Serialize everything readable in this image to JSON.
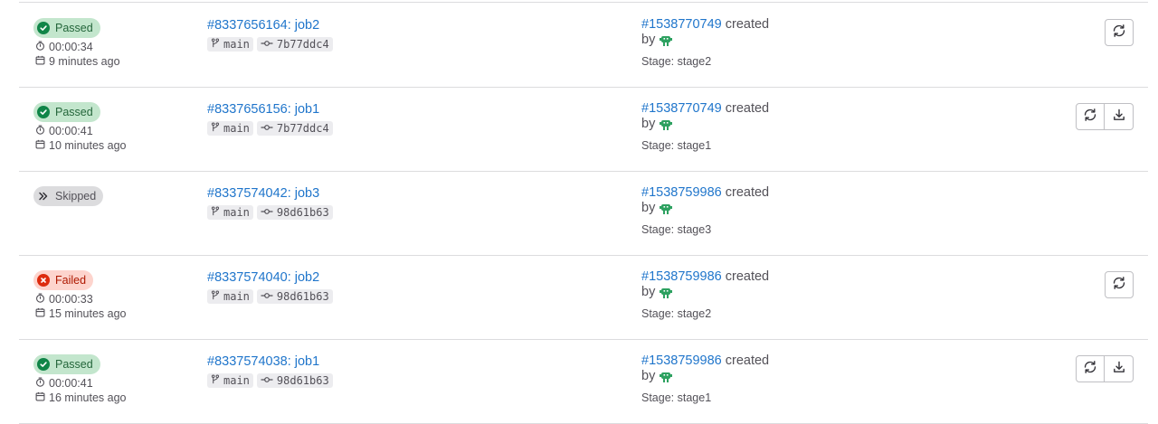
{
  "rows": [
    {
      "status": "Passed",
      "status_kind": "success",
      "duration": "00:00:34",
      "finished": "9 minutes ago",
      "job": "#8337656164: job2",
      "ref": "main",
      "commit": "7b77ddc4",
      "pipeline": "#1538770749",
      "created": "created",
      "by": "by",
      "stage": "Stage: stage2",
      "actions": [
        "retry"
      ]
    },
    {
      "status": "Passed",
      "status_kind": "success",
      "duration": "00:00:41",
      "finished": "10 minutes ago",
      "job": "#8337656156: job1",
      "ref": "main",
      "commit": "7b77ddc4",
      "pipeline": "#1538770749",
      "created": "created",
      "by": "by",
      "stage": "Stage: stage1",
      "actions": [
        "retry",
        "download"
      ]
    },
    {
      "status": "Skipped",
      "status_kind": "skipped",
      "duration": "",
      "finished": "",
      "job": "#8337574042: job3",
      "ref": "main",
      "commit": "98d61b63",
      "pipeline": "#1538759986",
      "created": "created",
      "by": "by",
      "stage": "Stage: stage3",
      "actions": []
    },
    {
      "status": "Failed",
      "status_kind": "failed",
      "duration": "00:00:33",
      "finished": "15 minutes ago",
      "job": "#8337574040: job2",
      "ref": "main",
      "commit": "98d61b63",
      "pipeline": "#1538759986",
      "created": "created",
      "by": "by",
      "stage": "Stage: stage2",
      "actions": [
        "retry"
      ]
    },
    {
      "status": "Passed",
      "status_kind": "success",
      "duration": "00:00:41",
      "finished": "16 minutes ago",
      "job": "#8337574038: job1",
      "ref": "main",
      "commit": "98d61b63",
      "pipeline": "#1538759986",
      "created": "created",
      "by": "by",
      "stage": "Stage: stage1",
      "actions": [
        "retry",
        "download"
      ]
    }
  ],
  "icons": {
    "success": "check-circle-icon",
    "failed": "close-circle-icon",
    "skipped": "skipped-icon",
    "duration": "timer-icon",
    "finished": "calendar-icon",
    "ref": "branch-icon",
    "commit": "commit-icon",
    "avatar": "bot-avatar-icon",
    "retry": "retry-icon",
    "download": "download-icon"
  },
  "colors": {
    "link": "#1f75cb",
    "success": "#108548",
    "failed": "#dd2b0e",
    "avatar": "#2da160"
  }
}
